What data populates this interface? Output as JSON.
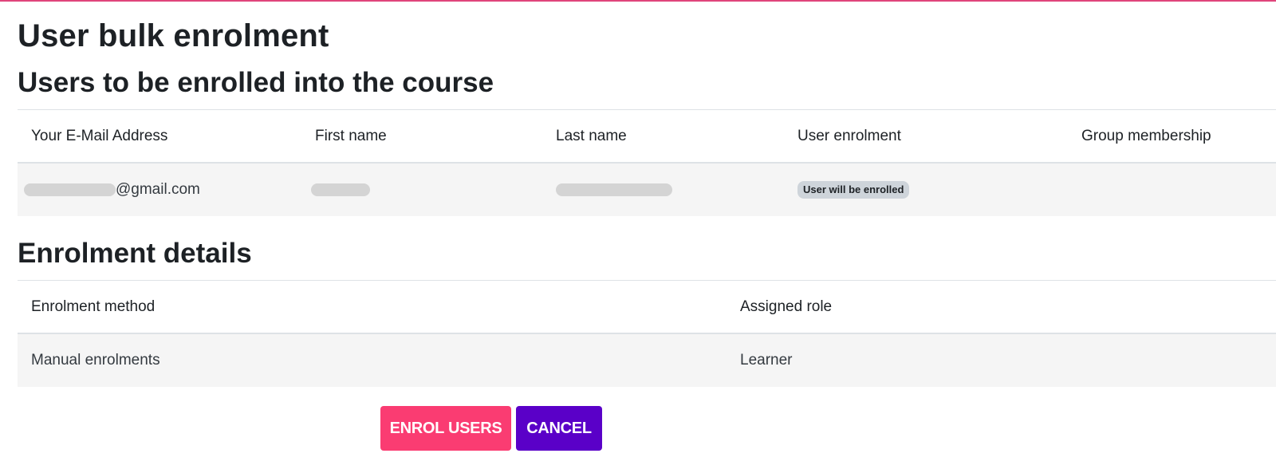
{
  "page": {
    "title": "User bulk enrolment"
  },
  "users_section": {
    "title": "Users to be enrolled into the course",
    "columns": [
      "Your E-Mail Address",
      "First name",
      "Last name",
      "User enrolment",
      "Group membership"
    ],
    "rows": [
      {
        "email_suffix": "@gmail.com",
        "first_name": "",
        "last_name": "",
        "enrolment_status": "User will be enrolled",
        "group_membership": ""
      }
    ]
  },
  "enrolment_section": {
    "title": "Enrolment details",
    "columns": [
      "Enrolment method",
      "Assigned role"
    ],
    "rows": [
      {
        "method": "Manual enrolments",
        "role": "Learner"
      }
    ]
  },
  "actions": {
    "enrol_label": "ENROL USERS",
    "cancel_label": "CANCEL"
  },
  "colors": {
    "accent": "#e0457b",
    "primary_button": "#fa3c72",
    "secondary_button": "#5a00c8",
    "row_background": "#f5f5f5",
    "badge_background": "#ced4da"
  }
}
